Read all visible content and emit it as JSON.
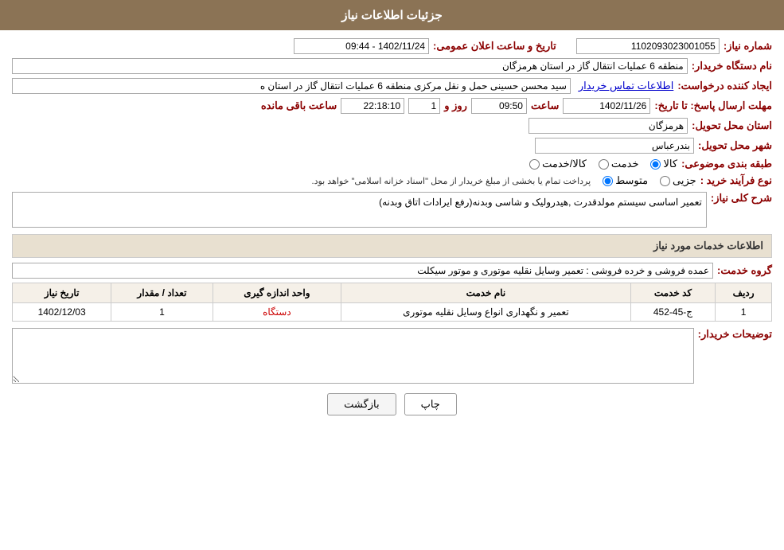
{
  "header": {
    "title": "جزئیات اطلاعات نیاز"
  },
  "fields": {
    "request_number_label": "شماره نیاز:",
    "request_number_value": "1102093023001055",
    "date_label": "تاریخ و ساعت اعلان عمومی:",
    "date_value": "1402/11/24 - 09:44",
    "requester_org_label": "نام دستگاه خریدار:",
    "requester_org_value": "منطقه 6 عملیات انتقال گاز در استان هرمزگان",
    "creator_label": "ایجاد کننده درخواست:",
    "creator_value": "سید محسن حسینی حمل و نقل مرکزی منطقه 6 عملیات انتقال گاز در استان ه",
    "creator_link": "اطلاعات تماس خریدار",
    "deadline_label": "مهلت ارسال پاسخ: تا تاریخ:",
    "deadline_date": "1402/11/26",
    "deadline_time_label": "ساعت",
    "deadline_time": "09:50",
    "deadline_day_label": "روز و",
    "deadline_days": "1",
    "deadline_remaining_label": "ساعت باقی مانده",
    "deadline_remaining": "22:18:10",
    "delivery_province_label": "استان محل تحویل:",
    "delivery_province_value": "هرمزگان",
    "delivery_city_label": "شهر محل تحویل:",
    "delivery_city_value": "بندرعباس",
    "category_label": "طبقه بندی موضوعی:",
    "category_options": [
      "کالا",
      "خدمت",
      "کالا/خدمت"
    ],
    "category_selected": "کالا",
    "purchase_type_label": "نوع فرآیند خرید :",
    "purchase_type_options": [
      "جزیی",
      "متوسط"
    ],
    "purchase_type_selected": "متوسط",
    "purchase_type_note": "پرداخت تمام یا بخشی از مبلغ خریدار از محل \"اسناد خزانه اسلامی\" خواهد بود.",
    "description_label": "شرح کلی نیاز:",
    "description_value": "تعمیر اساسی سیستم مولدقدرت ,هیدرولیک و شاسی وبدنه(رفع ایرادات اتاق وبدنه)",
    "services_section_title": "اطلاعات خدمات مورد نیاز",
    "service_group_label": "گروه خدمت:",
    "service_group_value": "عمده فروشی و خرده فروشی : تعمیر وسایل نقلیه موتوری و موتور سیکلت",
    "table": {
      "headers": [
        "ردیف",
        "کد خدمت",
        "نام خدمت",
        "واحد اندازه گیری",
        "تعداد / مقدار",
        "تاریخ نیاز"
      ],
      "rows": [
        {
          "row_num": "1",
          "code": "ج-45-452",
          "name": "تعمیر و نگهداری انواع وسایل نقلیه موتوری",
          "unit": "دستگاه",
          "quantity": "1",
          "date": "1402/12/03"
        }
      ]
    },
    "buyer_notes_label": "توضیحات خریدار:",
    "buyer_notes_value": ""
  },
  "buttons": {
    "print_label": "چاپ",
    "back_label": "بازگشت"
  }
}
